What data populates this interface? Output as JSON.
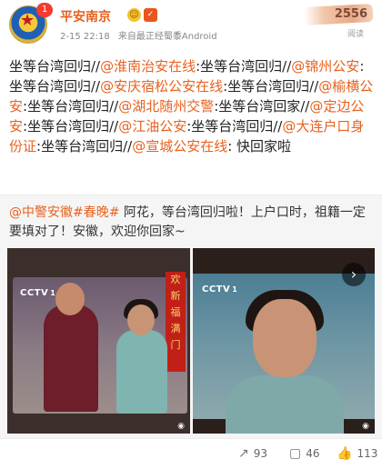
{
  "post": {
    "badge": "1",
    "author": "平安南京",
    "time": "2-15 22:18",
    "source": "来自最正经蜀黍Android",
    "read_count": "2556",
    "read_label": "阅读",
    "segments": [
      {
        "text": "坐等台湾回归//",
        "mention": false
      },
      {
        "text": "@淮南治安在线",
        "mention": true
      },
      {
        "text": ":坐等台湾回归//",
        "mention": false
      },
      {
        "text": "@锦州公安",
        "mention": true
      },
      {
        "text": ":坐等台湾回归//",
        "mention": false
      },
      {
        "text": "@安庆宿松公安在线",
        "mention": true
      },
      {
        "text": ":坐等台湾回归//",
        "mention": false
      },
      {
        "text": "@榆横公安",
        "mention": true
      },
      {
        "text": ":坐等台湾回归//",
        "mention": false
      },
      {
        "text": "@湖北随州交警",
        "mention": true
      },
      {
        "text": ":坐等台湾回家//",
        "mention": false
      },
      {
        "text": "@定边公安",
        "mention": true
      },
      {
        "text": ":坐等台湾回归//",
        "mention": false
      },
      {
        "text": "@江油公安",
        "mention": true
      },
      {
        "text": ":坐等台湾回归//",
        "mention": false
      },
      {
        "text": "@大连户口身份证",
        "mention": true
      },
      {
        "text": ":坐等台湾回归//",
        "mention": false
      },
      {
        "text": "@宣城公安在线",
        "mention": true
      },
      {
        "text": ": 快回家啦",
        "mention": false
      }
    ]
  },
  "repost": {
    "mention": "@中警安徽",
    "topic": "#春晚#",
    "text": " 阿花，等台湾回归啦！上户口时，祖籍一定要填对了！安徽，欢迎你回家~"
  },
  "images": {
    "tv_logo": "CCTV",
    "tv_logo_sub": "1",
    "banner_chars": [
      "欢",
      "新",
      "福",
      "满",
      "门"
    ],
    "next_glyph": "›"
  },
  "actions": {
    "repost_count": "93",
    "comment_count": "46",
    "like_count": "113"
  },
  "colors": {
    "accent": "#e8611e",
    "badge": "#f53b2f",
    "repost_bg": "#f5f5f5"
  }
}
